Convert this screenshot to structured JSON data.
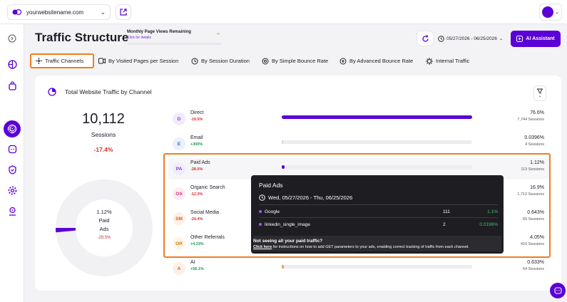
{
  "topbar": {
    "site": "yourwebsitename.com"
  },
  "page": {
    "title": "Traffic Structure",
    "monthly_views_label": "Monthly Page Views Remaining",
    "monthly_views_link": "Click for details",
    "monthly_views_value": "∞",
    "date_range": "05/27/2026 - 06/25/2026",
    "ai_button": "AI Assistant"
  },
  "tabs": [
    {
      "label": "Traffic Channels",
      "icon": "channels-icon"
    },
    {
      "label": "By Visited Pages per Session",
      "icon": "pages-icon"
    },
    {
      "label": "By Session Duration",
      "icon": "clock-icon"
    },
    {
      "label": "By Simple Bounce Rate",
      "icon": "bounce-icon"
    },
    {
      "label": "By Advanced Bounce Rate",
      "icon": "advanced-bounce-icon"
    },
    {
      "label": "Internal Traffic",
      "icon": "internal-icon"
    }
  ],
  "card": {
    "title": "Total Website Traffic by Channel",
    "sessions_value": "10,112",
    "sessions_label": "Sessions",
    "sessions_delta": "-17.4%",
    "donut_pct": "1.12%",
    "donut_name_1": "Paid",
    "donut_name_2": "Ads",
    "donut_delta": "-28.5%"
  },
  "channels": [
    {
      "badge": "D",
      "name": "Direct",
      "delta": "-19.5%",
      "trend": "neg",
      "pct": "76.6%",
      "sessions": "7,744 Sessions",
      "share": 0.766,
      "color": "#7c3aed",
      "bg": "#f1ecfd"
    },
    {
      "badge": "E",
      "name": "Email",
      "delta": "+300%",
      "trend": "pos",
      "pct": "0.0396%",
      "sessions": "4 Sessions",
      "share": 0.000396,
      "color": "#2563eb",
      "bg": "#eaf1fd"
    },
    {
      "badge": "PA",
      "name": "Paid Ads",
      "delta": "-28.5%",
      "trend": "neg",
      "pct": "1.12%",
      "sessions": "113 Sessions",
      "share": 0.0112,
      "color": "#7c3aed",
      "bg": "#f1ecfd"
    },
    {
      "badge": "OS",
      "name": "Organic Search",
      "delta": "-12.3%",
      "trend": "neg",
      "pct": "16.9%",
      "sessions": "1,712 Sessions",
      "share": 0.169,
      "color": "#db2777",
      "bg": "#fdecf3"
    },
    {
      "badge": "SM",
      "name": "Social Media",
      "delta": "-24.4%",
      "trend": "neg",
      "pct": "0.643%",
      "sessions": "65 Sessions",
      "share": 0.00643,
      "color": "#ea580c",
      "bg": "#fdf0e8"
    },
    {
      "badge": "OR",
      "name": "Other Referrals",
      "delta": "+4.33%",
      "trend": "pos",
      "pct": "4.05%",
      "sessions": "410 Sessions",
      "share": 0.0405,
      "color": "#d97706",
      "bg": "#fdf5e6"
    },
    {
      "badge": "A",
      "name": "AI",
      "delta": "+56.1%",
      "trend": "pos",
      "pct": "0.633%",
      "sessions": "64 Sessions",
      "share": 0.00633,
      "color": "#ea580c",
      "bg": "#fdf0e8"
    }
  ],
  "tooltip": {
    "title": "Paid Ads",
    "date": "Wed, 05/27/2026 - Thu, 06/25/2026",
    "rows": [
      {
        "name": "Google",
        "count": "111",
        "pct": "1.1%"
      },
      {
        "name": "linkedin_single_image",
        "count": "2",
        "pct": "0.0198%"
      }
    ],
    "footer_q": "Not seeing all your paid traffic?",
    "footer_link": "Click here",
    "footer_text": " for instructions on how to add GET parameters to your ads, enabling correct tracking of traffic from each channel."
  },
  "colors": {
    "brand": "#5b00d6",
    "highlight": "#f07c1e"
  }
}
